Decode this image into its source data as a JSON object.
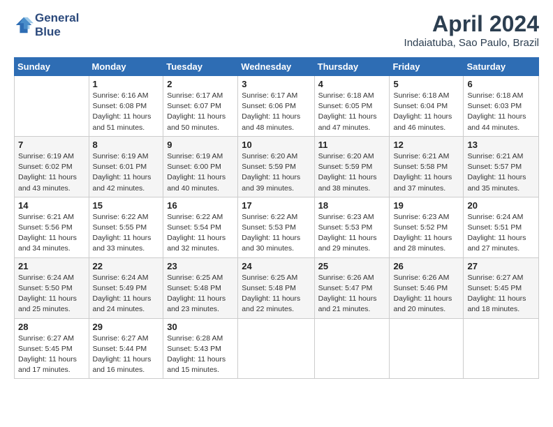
{
  "header": {
    "logo_line1": "General",
    "logo_line2": "Blue",
    "month_title": "April 2024",
    "subtitle": "Indaiatuba, Sao Paulo, Brazil"
  },
  "weekdays": [
    "Sunday",
    "Monday",
    "Tuesday",
    "Wednesday",
    "Thursday",
    "Friday",
    "Saturday"
  ],
  "weeks": [
    [
      {
        "day": "",
        "info": ""
      },
      {
        "day": "1",
        "info": "Sunrise: 6:16 AM\nSunset: 6:08 PM\nDaylight: 11 hours\nand 51 minutes."
      },
      {
        "day": "2",
        "info": "Sunrise: 6:17 AM\nSunset: 6:07 PM\nDaylight: 11 hours\nand 50 minutes."
      },
      {
        "day": "3",
        "info": "Sunrise: 6:17 AM\nSunset: 6:06 PM\nDaylight: 11 hours\nand 48 minutes."
      },
      {
        "day": "4",
        "info": "Sunrise: 6:18 AM\nSunset: 6:05 PM\nDaylight: 11 hours\nand 47 minutes."
      },
      {
        "day": "5",
        "info": "Sunrise: 6:18 AM\nSunset: 6:04 PM\nDaylight: 11 hours\nand 46 minutes."
      },
      {
        "day": "6",
        "info": "Sunrise: 6:18 AM\nSunset: 6:03 PM\nDaylight: 11 hours\nand 44 minutes."
      }
    ],
    [
      {
        "day": "7",
        "info": "Sunrise: 6:19 AM\nSunset: 6:02 PM\nDaylight: 11 hours\nand 43 minutes."
      },
      {
        "day": "8",
        "info": "Sunrise: 6:19 AM\nSunset: 6:01 PM\nDaylight: 11 hours\nand 42 minutes."
      },
      {
        "day": "9",
        "info": "Sunrise: 6:19 AM\nSunset: 6:00 PM\nDaylight: 11 hours\nand 40 minutes."
      },
      {
        "day": "10",
        "info": "Sunrise: 6:20 AM\nSunset: 5:59 PM\nDaylight: 11 hours\nand 39 minutes."
      },
      {
        "day": "11",
        "info": "Sunrise: 6:20 AM\nSunset: 5:59 PM\nDaylight: 11 hours\nand 38 minutes."
      },
      {
        "day": "12",
        "info": "Sunrise: 6:21 AM\nSunset: 5:58 PM\nDaylight: 11 hours\nand 37 minutes."
      },
      {
        "day": "13",
        "info": "Sunrise: 6:21 AM\nSunset: 5:57 PM\nDaylight: 11 hours\nand 35 minutes."
      }
    ],
    [
      {
        "day": "14",
        "info": "Sunrise: 6:21 AM\nSunset: 5:56 PM\nDaylight: 11 hours\nand 34 minutes."
      },
      {
        "day": "15",
        "info": "Sunrise: 6:22 AM\nSunset: 5:55 PM\nDaylight: 11 hours\nand 33 minutes."
      },
      {
        "day": "16",
        "info": "Sunrise: 6:22 AM\nSunset: 5:54 PM\nDaylight: 11 hours\nand 32 minutes."
      },
      {
        "day": "17",
        "info": "Sunrise: 6:22 AM\nSunset: 5:53 PM\nDaylight: 11 hours\nand 30 minutes."
      },
      {
        "day": "18",
        "info": "Sunrise: 6:23 AM\nSunset: 5:53 PM\nDaylight: 11 hours\nand 29 minutes."
      },
      {
        "day": "19",
        "info": "Sunrise: 6:23 AM\nSunset: 5:52 PM\nDaylight: 11 hours\nand 28 minutes."
      },
      {
        "day": "20",
        "info": "Sunrise: 6:24 AM\nSunset: 5:51 PM\nDaylight: 11 hours\nand 27 minutes."
      }
    ],
    [
      {
        "day": "21",
        "info": "Sunrise: 6:24 AM\nSunset: 5:50 PM\nDaylight: 11 hours\nand 25 minutes."
      },
      {
        "day": "22",
        "info": "Sunrise: 6:24 AM\nSunset: 5:49 PM\nDaylight: 11 hours\nand 24 minutes."
      },
      {
        "day": "23",
        "info": "Sunrise: 6:25 AM\nSunset: 5:48 PM\nDaylight: 11 hours\nand 23 minutes."
      },
      {
        "day": "24",
        "info": "Sunrise: 6:25 AM\nSunset: 5:48 PM\nDaylight: 11 hours\nand 22 minutes."
      },
      {
        "day": "25",
        "info": "Sunrise: 6:26 AM\nSunset: 5:47 PM\nDaylight: 11 hours\nand 21 minutes."
      },
      {
        "day": "26",
        "info": "Sunrise: 6:26 AM\nSunset: 5:46 PM\nDaylight: 11 hours\nand 20 minutes."
      },
      {
        "day": "27",
        "info": "Sunrise: 6:27 AM\nSunset: 5:45 PM\nDaylight: 11 hours\nand 18 minutes."
      }
    ],
    [
      {
        "day": "28",
        "info": "Sunrise: 6:27 AM\nSunset: 5:45 PM\nDaylight: 11 hours\nand 17 minutes."
      },
      {
        "day": "29",
        "info": "Sunrise: 6:27 AM\nSunset: 5:44 PM\nDaylight: 11 hours\nand 16 minutes."
      },
      {
        "day": "30",
        "info": "Sunrise: 6:28 AM\nSunset: 5:43 PM\nDaylight: 11 hours\nand 15 minutes."
      },
      {
        "day": "",
        "info": ""
      },
      {
        "day": "",
        "info": ""
      },
      {
        "day": "",
        "info": ""
      },
      {
        "day": "",
        "info": ""
      }
    ]
  ]
}
